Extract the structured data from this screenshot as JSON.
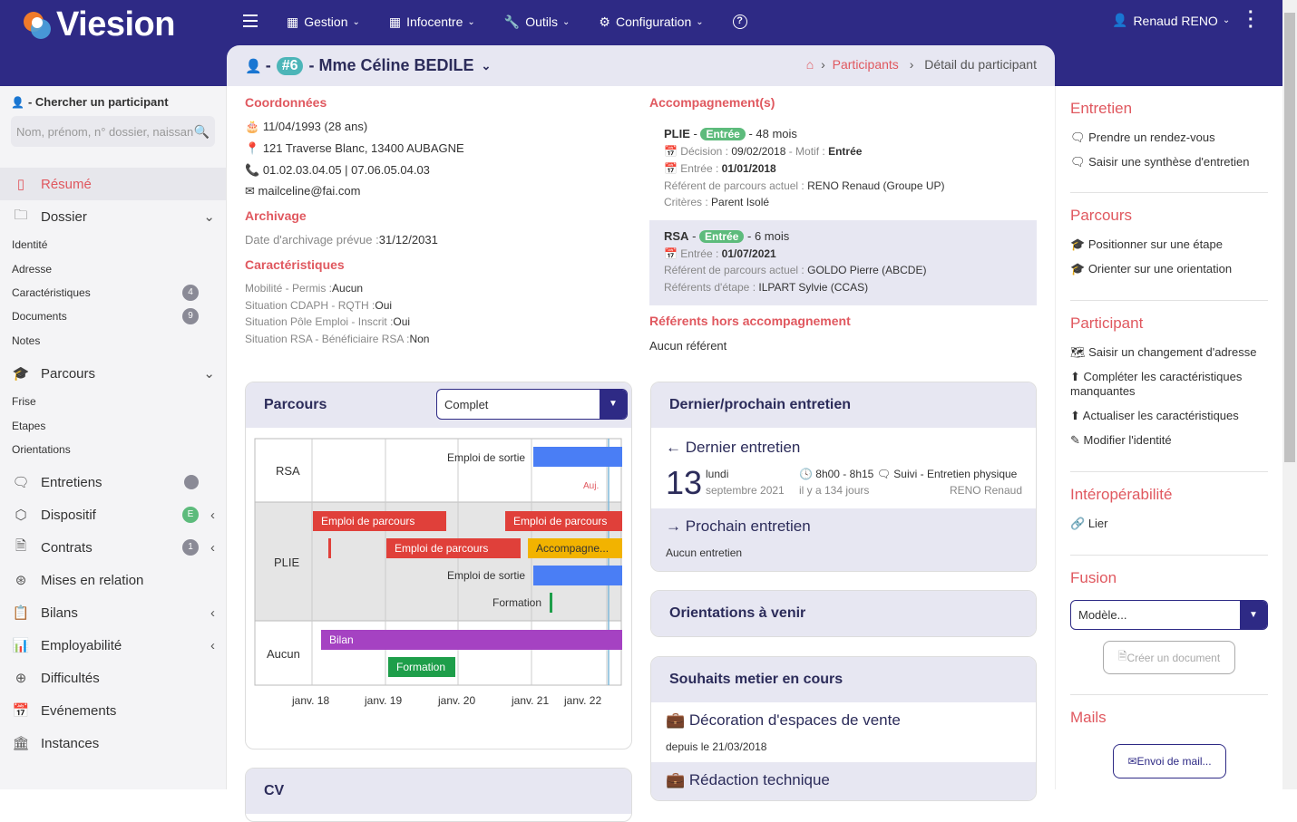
{
  "app": {
    "name": "Viesion"
  },
  "nav": {
    "gestion": "Gestion",
    "infocentre": "Infocentre",
    "outils": "Outils",
    "configuration": "Configuration"
  },
  "user": {
    "name": "Renaud RENO"
  },
  "participant": {
    "id": "#6",
    "name": "Mme Céline BEDILE",
    "prefix": "-"
  },
  "breadcrumb": {
    "participants": "Participants",
    "sep": "›",
    "current": "Détail du participant"
  },
  "sidebar": {
    "search_label": "- Chercher un participant",
    "search_placeholder": "Nom, prénom, n° dossier, naissance",
    "items": [
      {
        "label": "Résumé"
      },
      {
        "label": "Dossier"
      },
      {
        "label": "Parcours"
      },
      {
        "label": "Entretiens"
      },
      {
        "label": "Dispositif"
      },
      {
        "label": "Contrats"
      },
      {
        "label": "Mises en relation"
      },
      {
        "label": "Bilans"
      },
      {
        "label": "Employabilité"
      },
      {
        "label": "Difficultés"
      },
      {
        "label": "Evénements"
      },
      {
        "label": "Instances"
      }
    ],
    "dossier_sub": [
      "Identité",
      "Adresse",
      "Caractéristiques",
      "Documents",
      "Notes"
    ],
    "parcours_sub": [
      "Frise",
      "Etapes",
      "Orientations"
    ],
    "counts": {
      "caracteristiques": "4",
      "documents": "9",
      "dispositif": "E",
      "contrats": "1"
    }
  },
  "coordonnees": {
    "title": "Coordonnées",
    "birth": "11/04/1993 (28 ans)",
    "address": "121 Traverse Blanc, 13400 AUBAGNE",
    "phone": "01.02.03.04.05 | 07.06.05.04.03",
    "email": "mailceline@fai.com"
  },
  "archivage": {
    "title": "Archivage",
    "label": "Date d'archivage prévue :",
    "value": "31/12/2031"
  },
  "caracteristiques": {
    "title": "Caractéristiques",
    "rows": [
      {
        "label": "Mobilité - Permis :",
        "value": "Aucun"
      },
      {
        "label": "Situation CDAPH - RQTH :",
        "value": "Oui"
      },
      {
        "label": "Situation Pôle Emploi - Inscrit :",
        "value": "Oui"
      },
      {
        "label": "Situation RSA - Bénéficiaire RSA :",
        "value": "Non"
      }
    ]
  },
  "accompagnements": {
    "title": "Accompagnement(s)",
    "plie": {
      "name": "PLIE",
      "status": "Entrée",
      "duree": "- 48 mois",
      "decision_label": "Décision :",
      "decision": "09/02/2018",
      "motif_label": "- Motif :",
      "motif": "Entrée",
      "entree_label": "Entrée :",
      "entree": "01/01/2018",
      "ref_label": "Référent de parcours actuel :",
      "ref": "RENO Renaud (Groupe UP)",
      "crit_label": "Critères :",
      "crit": "Parent Isolé"
    },
    "rsa": {
      "name": "RSA",
      "status": "Entrée",
      "duree": "- 6 mois",
      "entree_label": "Entrée :",
      "entree": "01/07/2021",
      "ref_label": "Référent de parcours actuel :",
      "ref": "GOLDO Pierre (ABCDE)",
      "refe_label": "Référents d'étape :",
      "refe": "ILPART Sylvie (CCAS)"
    }
  },
  "referents_hors": {
    "title": "Référents hors accompagnement",
    "value": "Aucun référent"
  },
  "parcours_card": {
    "title": "Parcours",
    "select": "Complet",
    "rows": [
      "RSA",
      "PLIE",
      "Aucun"
    ],
    "ticks": [
      "janv. 18",
      "janv. 19",
      "janv. 20",
      "janv. 21",
      "janv. 22"
    ],
    "today_label": "Auj.",
    "bar_labels": {
      "emploi_sortie": "Emploi de sortie",
      "emploi_parcours": "Emploi de parcours",
      "accompagnement": "Accompagne...",
      "formation": "Formation",
      "bilan": "Bilan"
    }
  },
  "entretien_card": {
    "title": "Dernier/prochain entretien",
    "dernier": "Dernier entretien",
    "day": "13",
    "weekday": "lundi",
    "month": "septembre 2021",
    "time": "8h00 - 8h15",
    "type": "Suivi - Entretien physique",
    "ago": "il y a 134 jours",
    "who": "RENO Renaud",
    "prochain": "Prochain entretien",
    "aucun": "Aucun entretien"
  },
  "orientations_card": {
    "title": "Orientations à venir"
  },
  "souhaits_card": {
    "title": "Souhaits metier en cours",
    "item1": "Décoration d'espaces de vente",
    "item1_since": "depuis le 21/03/2018",
    "item2": "Rédaction technique"
  },
  "cv_card": {
    "title": "CV"
  },
  "right": {
    "entretien": {
      "title": "Entretien",
      "a1": "Prendre un rendez-vous",
      "a2": "Saisir une synthèse d'entretien"
    },
    "parcours": {
      "title": "Parcours",
      "a1": "Positionner sur une étape",
      "a2": "Orienter sur une orientation"
    },
    "participant": {
      "title": "Participant",
      "a1": "Saisir un changement d'adresse",
      "a2": "Compléter les caractéristiques manquantes",
      "a3": "Actualiser les caractéristiques",
      "a4": "Modifier l'identité"
    },
    "interop": {
      "title": "Intéropérabilité",
      "a1": "Lier"
    },
    "fusion": {
      "title": "Fusion",
      "select": "Modèle...",
      "button": "Créer un document"
    },
    "mails": {
      "title": "Mails",
      "button": "Envoi de mail..."
    }
  },
  "colors": {
    "header": "#2e2a85",
    "accent": "#e0585f",
    "teal": "#4cb5b8",
    "green": "#5dbb7c",
    "blue": "#4a7ef5",
    "red": "#e0403a",
    "orange": "#f2b300",
    "purple": "#a542c2"
  }
}
